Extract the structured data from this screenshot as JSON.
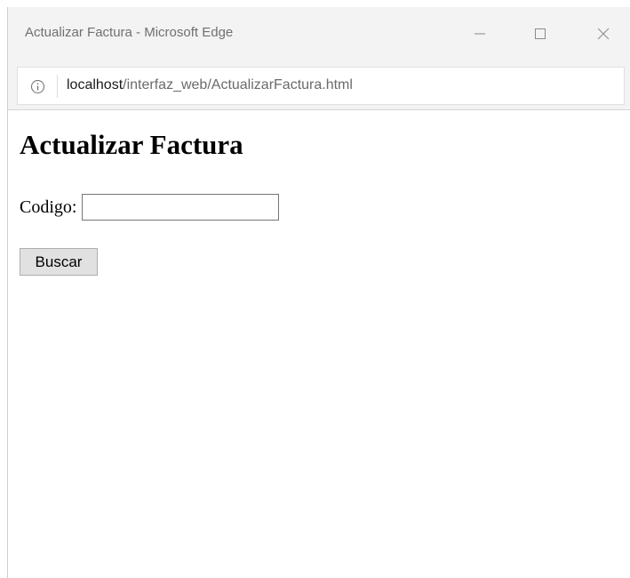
{
  "window": {
    "title": "Actualizar Factura - Microsoft Edge"
  },
  "address_bar": {
    "url_host": "localhost",
    "url_path": "/interfaz_web/ActualizarFactura.html",
    "info_icon": "info-icon"
  },
  "page": {
    "title": "Actualizar Factura",
    "codigo_label": "Codigo:",
    "codigo_value": "",
    "buscar_label": "Buscar"
  },
  "icons": {
    "minimize": "minimize-icon",
    "maximize": "maximize-icon",
    "close": "close-icon"
  },
  "colors": {
    "chrome_background": "#f3f3f3",
    "title_text": "#707070",
    "button_face": "#e1e1e1"
  }
}
